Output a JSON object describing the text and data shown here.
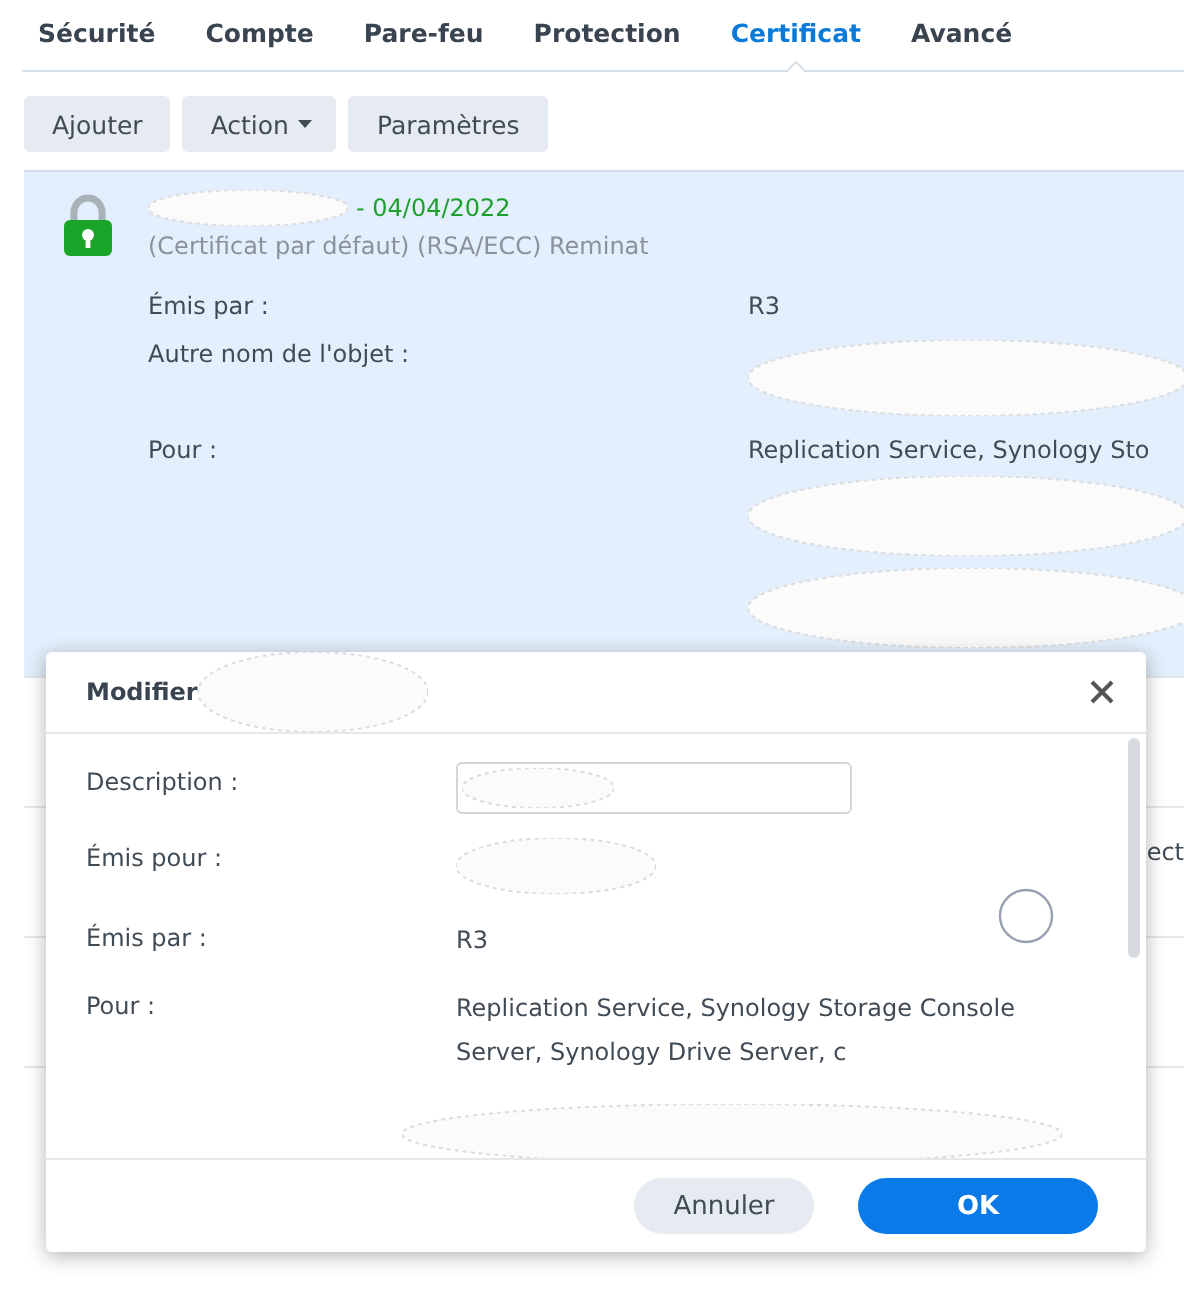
{
  "tabs": [
    {
      "label": "Sécurité",
      "selected": false
    },
    {
      "label": "Compte",
      "selected": false
    },
    {
      "label": "Pare-feu",
      "selected": false
    },
    {
      "label": "Protection",
      "selected": false
    },
    {
      "label": "Certificat",
      "selected": true
    },
    {
      "label": "Avancé",
      "selected": false
    }
  ],
  "toolbar": [
    {
      "label": "Ajouter",
      "dropdown": false
    },
    {
      "label": "Action",
      "dropdown": true
    },
    {
      "label": "Paramètres",
      "dropdown": false
    }
  ],
  "certificate": {
    "date": "- 04/04/2022",
    "subtitle": "(Certificat par défaut) (RSA/ECC) Reminat",
    "selected": true,
    "fields": [
      {
        "label": "Émis par :",
        "value": "R3"
      },
      {
        "label": "Autre nom de l'objet :"
      },
      {
        "label": "Pour :",
        "value": "Replication Service, Synology Sto"
      }
    ]
  },
  "background_text": "ect",
  "dialog": {
    "title": "Modifier",
    "fields": [
      {
        "label": "Description :",
        "kind": "input"
      },
      {
        "label": "Émis pour :",
        "kind": "text"
      },
      {
        "label": "Émis par :",
        "kind": "text",
        "value": "R3"
      },
      {
        "label": "Pour :",
        "kind": "text",
        "value": "Replication Service, Synology Storage Console Server, Synology Drive Server, c"
      }
    ],
    "buttons": [
      {
        "label": "Annuler",
        "primary": false
      },
      {
        "label": "OK",
        "primary": true
      }
    ]
  }
}
